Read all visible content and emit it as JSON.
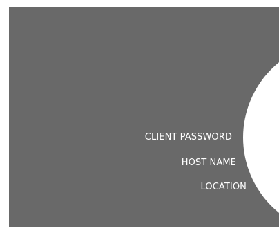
{
  "menu": {
    "items": [
      {
        "label": "CLIENT PASSWORD"
      },
      {
        "label": "HOST NAME"
      },
      {
        "label": "LOCATION"
      }
    ]
  },
  "colors": {
    "panel_background": "#696969",
    "dial": "#ffffff",
    "label_text": "#ffffff"
  }
}
